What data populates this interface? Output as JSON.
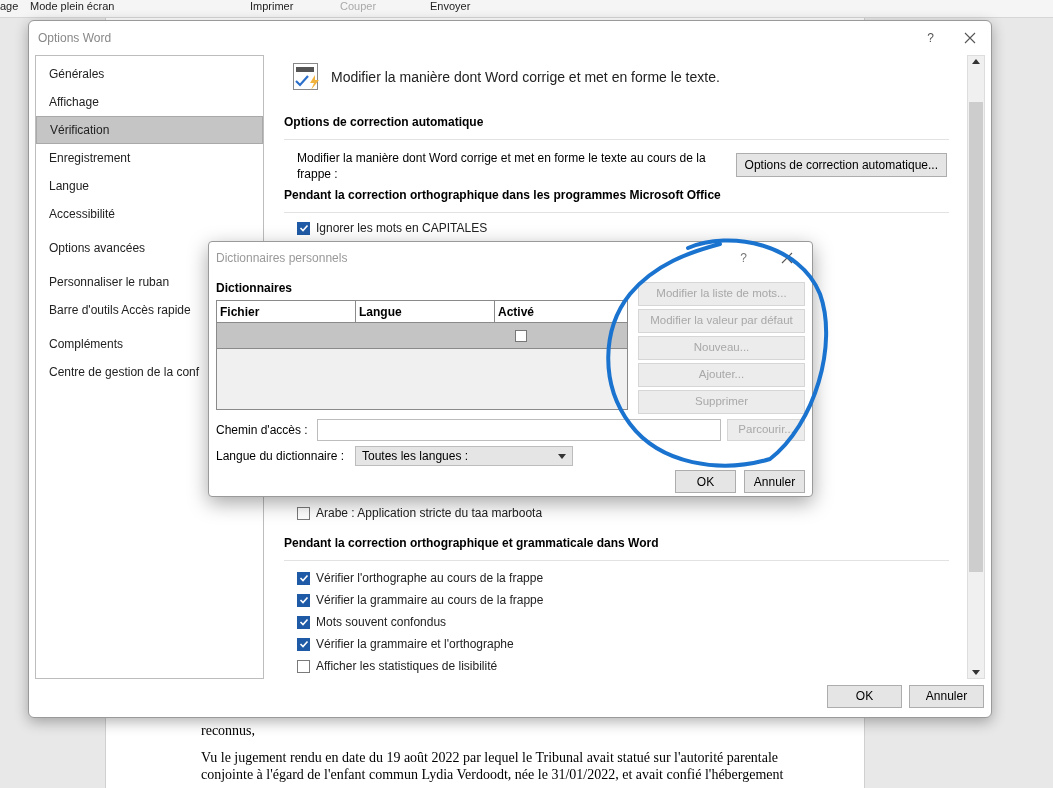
{
  "ribbon": {
    "items": [
      {
        "label": "age",
        "disabled": false
      },
      {
        "label": "Mode plein écran",
        "disabled": false
      },
      {
        "label": "Imprimer",
        "disabled": false
      },
      {
        "label": "Couper",
        "disabled": true
      },
      {
        "label": "Envoyer",
        "disabled": false
      }
    ]
  },
  "document": {
    "lines": [
      "reconnus,",
      "Vu le jugement rendu en date du 19 août 2022 par lequel le Tribunal avait statué sur l'autorité parentale",
      "conjointe à l'égard de l'enfant commun Lydia Verdoodt, née le 31/01/2022, et avait confié l'hébergement"
    ]
  },
  "options_window": {
    "title": "Options Word",
    "help": "?",
    "sidebar": {
      "groups": [
        [
          {
            "label": "Générales",
            "selected": false
          },
          {
            "label": "Affichage",
            "selected": false
          },
          {
            "label": "Vérification",
            "selected": true
          },
          {
            "label": "Enregistrement",
            "selected": false
          },
          {
            "label": "Langue",
            "selected": false
          },
          {
            "label": "Accessibilité",
            "selected": false
          }
        ],
        [
          {
            "label": "Options avancées",
            "selected": false
          }
        ],
        [
          {
            "label": "Personnaliser le ruban",
            "selected": false
          },
          {
            "label": "Barre d'outils Accès rapide",
            "selected": false
          }
        ],
        [
          {
            "label": "Compléments",
            "selected": false
          },
          {
            "label": "Centre de gestion de la conf",
            "selected": false
          }
        ]
      ]
    },
    "header": "Modifier la manière dont Word corrige et met en forme le texte.",
    "autocorrect": {
      "title": "Options de correction automatique",
      "description": "Modifier la manière dont Word corrige et met en forme le texte au cours de la frappe :",
      "button": "Options de correction automatique..."
    },
    "office_section": {
      "title": "Pendant la correction orthographique dans les programmes Microsoft Office",
      "options_top": [
        {
          "label": "Ignorer les mots en CAPITALES",
          "checked": true
        }
      ],
      "options_bottom": [
        {
          "label": "Arabe : Application stricte du taa marboota",
          "checked": false
        }
      ]
    },
    "word_section": {
      "title": "Pendant la correction orthographique et grammaticale dans Word",
      "options": [
        {
          "label": "Vérifier l'orthographe au cours de la frappe",
          "checked": true
        },
        {
          "label": "Vérifier la grammaire au cours de la frappe",
          "checked": true
        },
        {
          "label": "Mots souvent confondus",
          "checked": true
        },
        {
          "label": "Vérifier la grammaire et l'orthographe",
          "checked": true
        },
        {
          "label": "Afficher les statistiques de lisibilité",
          "checked": false
        }
      ]
    },
    "buttons": [
      "OK",
      "Annuler"
    ]
  },
  "dictionary_dialog": {
    "title": "Dictionnaires personnels",
    "help": "?",
    "section": "Dictionnaires",
    "columns": [
      "Fichier",
      "Langue",
      "Activé"
    ],
    "rows": [
      {
        "selected": true,
        "checked": false
      }
    ],
    "side_buttons": [
      {
        "label": "Modifier la liste de mots...",
        "disabled": true
      },
      {
        "label": "Modifier la valeur par défaut",
        "disabled": true
      },
      {
        "label": "Nouveau...",
        "disabled": true
      },
      {
        "label": "Ajouter...",
        "disabled": true
      },
      {
        "label": "Supprimer",
        "disabled": true
      }
    ],
    "path": {
      "label": "Chemin d'accès :",
      "browse": {
        "label": "Parcourir...",
        "disabled": true
      }
    },
    "language": {
      "label": "Langue du dictionnaire :",
      "value": "Toutes les langues :"
    },
    "buttons": [
      "OK",
      "Annuler"
    ]
  }
}
